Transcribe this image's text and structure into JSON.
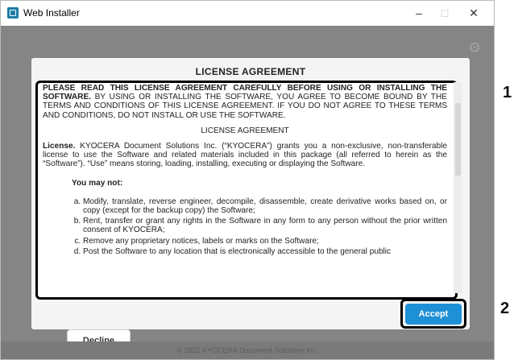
{
  "window": {
    "title": "Web Installer",
    "minimize": "–",
    "maximize": "□",
    "close": "✕"
  },
  "settings_icon": "⚙",
  "dialog": {
    "title": "LICENSE AGREEMENT",
    "intro_bold": "PLEASE READ THIS LICENSE AGREEMENT CAREFULLY BEFORE USING OR INSTALLING THE SOFTWARE.",
    "intro_rest": " BY USING OR INSTALLING THE SOFTWARE, YOU AGREE TO BECOME BOUND BY THE TERMS AND CONDITIONS OF THIS LICENSE AGREEMENT. IF YOU DO NOT AGREE TO THESE TERMS AND CONDITIONS, DO NOT INSTALL OR USE THE SOFTWARE.",
    "heading": "LICENSE AGREEMENT",
    "license_bold": "License.",
    "license_text": " KYOCERA Document Solutions Inc. (“KYOCERA”) grants you a non-exclusive, non-transferable license to use the Software and related materials included in this package (all referred to herein as the “Software”). “Use” means storing, loading, installing, executing or displaying the Software.",
    "may_not": "You may not:",
    "items": [
      "Modify, translate, reverse engineer, decompile, disassemble, create derivative works based on, or copy (except for the backup copy) the Software;",
      "Rent, transfer or grant any rights in the Software in any form to any person without the prior written consent of KYOCERA;",
      "Remove any proprietary notices, labels or marks on the Software;",
      "Post the Software to any location that is electronically accessible to the general public"
    ],
    "decline_label": "Decline",
    "accept_label": "Accept"
  },
  "footer": "© 2022 KYOCERA Document Solutions Inc.",
  "callouts": {
    "one": "1",
    "two": "2"
  },
  "colors": {
    "accent": "#1e90d6",
    "overlay": "#858585"
  }
}
